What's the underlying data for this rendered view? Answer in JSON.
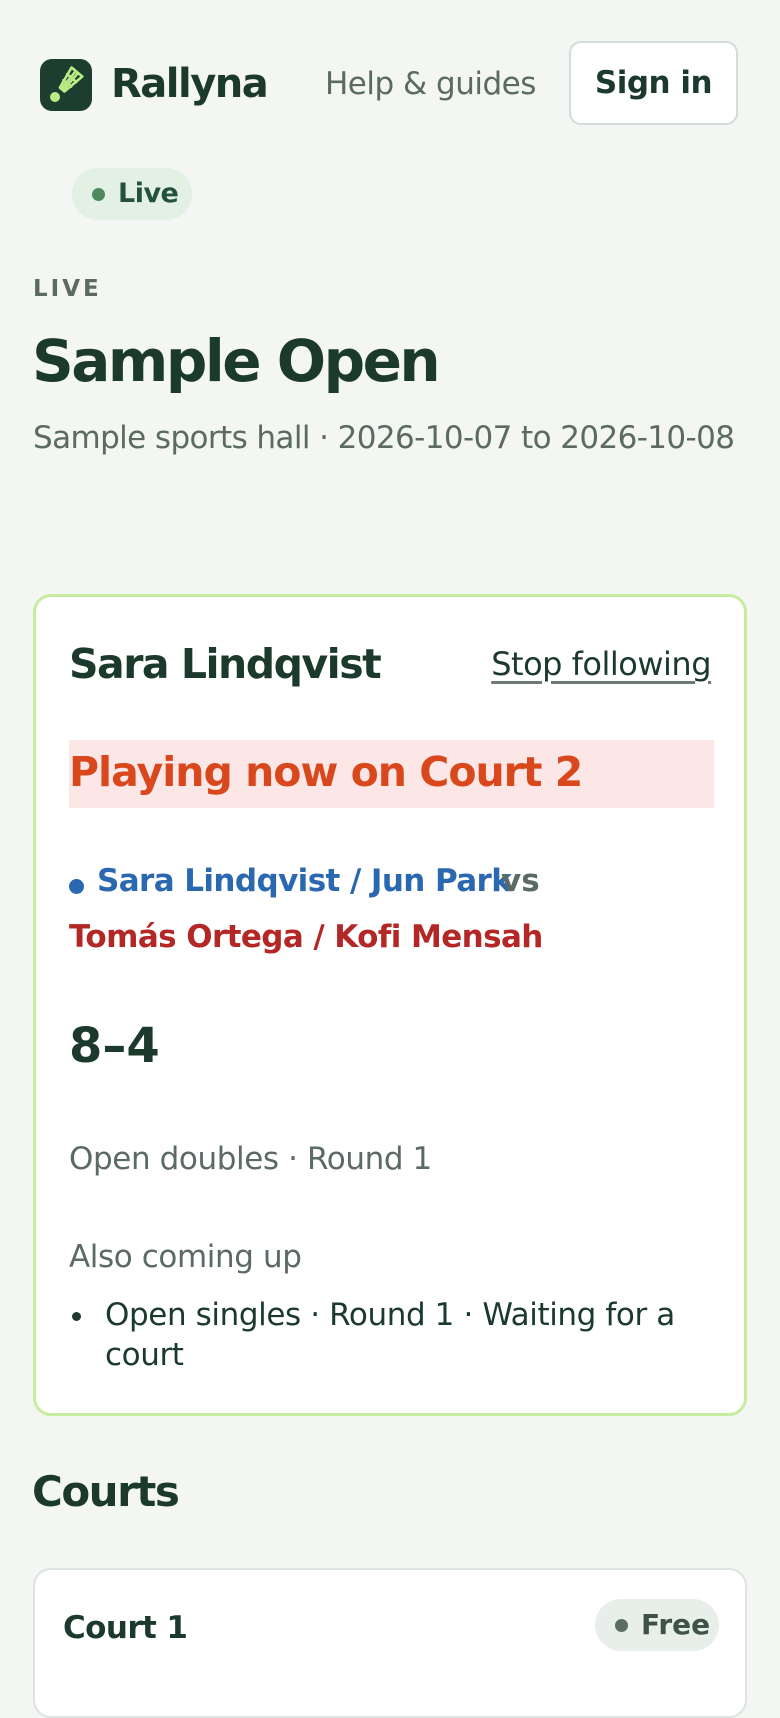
{
  "header": {
    "brand": "Rallyna",
    "logo_icon": "shuttlecock-icon",
    "help_link": "Help & guides",
    "signin_label": "Sign in"
  },
  "status_pill": "Live",
  "tournament": {
    "eyebrow": "LIVE",
    "title": "Sample Open",
    "subtitle": "Sample sports hall · 2026-10-07 to 2026-10-08"
  },
  "following": {
    "player": "Sara Lindqvist",
    "stop_label": "Stop following",
    "playing_now": "Playing now on Court 2",
    "team_a": "Sara Lindqvist / Jun Park",
    "vs": "vs",
    "team_b": "Tomás Ortega / Kofi Mensah",
    "score": "8–4",
    "meta": "Open doubles · Round 1",
    "coming_label": "Also coming up",
    "coming_items": [
      "Open singles · Round 1 · Waiting for a court"
    ]
  },
  "courts": {
    "heading": "Courts",
    "items": [
      {
        "name": "Court 1",
        "status": "Free"
      }
    ]
  },
  "colors": {
    "background": "#f3f6f3",
    "brand_dark": "#1b3a2c",
    "highlight_border": "#c7ec9e",
    "playing_now_text": "#d9481d",
    "playing_now_bg": "#fde6e6",
    "team_a": "#2a68b0",
    "team_b": "#b32827",
    "live_pill_bg": "#e2f1e4"
  }
}
